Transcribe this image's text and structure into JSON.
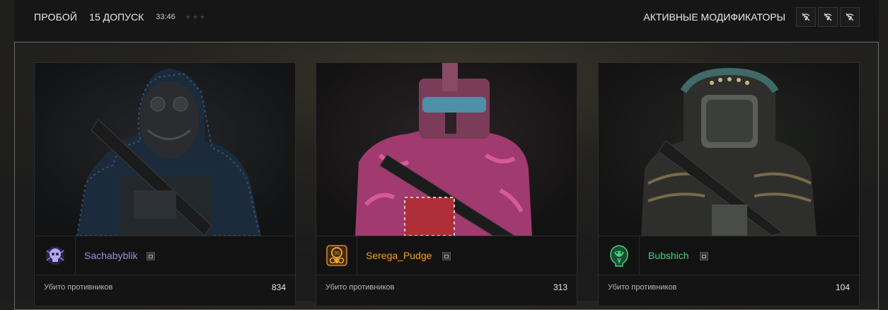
{
  "topbar": {
    "mode": "ПРОБОЙ",
    "level": "15 ДОПУСК",
    "time": "33:46",
    "stars_filled": 0,
    "stars_total": 3,
    "modifiers_label": "АКТИВНЫЕ МОДИФИКАТОРЫ",
    "modifiers": [
      {
        "icon": "no-signal-icon"
      },
      {
        "icon": "no-signal-icon"
      },
      {
        "icon": "no-signal-icon"
      }
    ]
  },
  "players": [
    {
      "name": "Sachabyblik",
      "name_color": "#9a8ce6",
      "avatar": "purple-skull-emblem-icon",
      "stat_label": "Убито противников",
      "kills": "834"
    },
    {
      "name": "Serega_Pudge",
      "name_color": "#f0a02a",
      "avatar": "orange-gasmask-emblem-icon",
      "stat_label": "Убито противников",
      "kills": "313"
    },
    {
      "name": "Bubshich",
      "name_color": "#3ed27e",
      "avatar": "green-cobra-emblem-icon",
      "stat_label": "Убито противников",
      "kills": "104"
    }
  ]
}
